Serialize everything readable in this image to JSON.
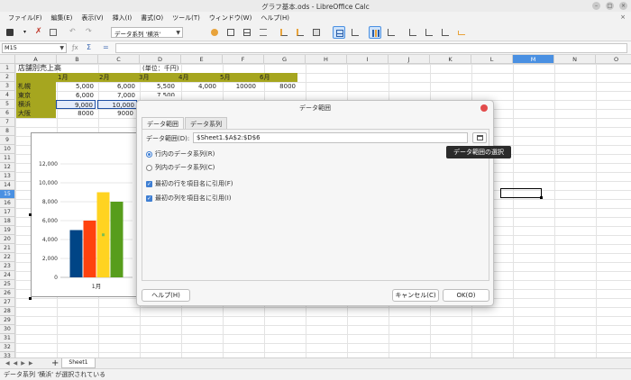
{
  "window": {
    "title": "グラフ基本.ods - LibreOffice Calc"
  },
  "menu": [
    "ファイル(F)",
    "編集(E)",
    "表示(V)",
    "挿入(I)",
    "書式(O)",
    "ツール(T)",
    "ウィンドウ(W)",
    "ヘルプ(H)"
  ],
  "toolbar": {
    "chart_element_combo": "データ系列 '横浜'"
  },
  "formula_bar": {
    "name_box": "M15",
    "sum_symbol": "Σ",
    "equals_symbol": "="
  },
  "sheet": {
    "columns": [
      "A",
      "B",
      "C",
      "D",
      "E",
      "F",
      "G",
      "H",
      "I",
      "J",
      "K",
      "L",
      "M",
      "N",
      "O"
    ],
    "active_column": "M",
    "rows": [
      "1",
      "2",
      "3",
      "4",
      "5",
      "6",
      "7",
      "8",
      "9",
      "10",
      "11",
      "12",
      "13",
      "14",
      "15",
      "16",
      "17",
      "18",
      "19",
      "20",
      "21",
      "22",
      "23",
      "24",
      "25",
      "26",
      "27",
      "28",
      "29",
      "30",
      "31",
      "32",
      "33"
    ],
    "active_row": "15",
    "title": "店舗別売上高",
    "unit": "(単位：千円)",
    "months": [
      "1月",
      "2月",
      "3月",
      "4月",
      "5月",
      "6月"
    ],
    "stores": [
      "札幌",
      "東京",
      "横浜",
      "大阪"
    ],
    "values": [
      [
        "5,000",
        "6,000",
        "5,500",
        "4,000",
        "10000",
        "8000"
      ],
      [
        "6,000",
        "7,000",
        "7,500",
        "",
        "",
        ""
      ],
      [
        "9,000",
        "10,000",
        "",
        "",
        "",
        ""
      ],
      [
        "8000",
        "9000",
        "",
        "",
        "",
        ""
      ]
    ]
  },
  "chart_data": {
    "type": "bar",
    "categories": [
      "1月"
    ],
    "series": [
      {
        "name": "札幌",
        "values": [
          5000
        ],
        "color": "#004586"
      },
      {
        "name": "東京",
        "values": [
          6000
        ],
        "color": "#ff420e"
      },
      {
        "name": "横浜",
        "values": [
          9000
        ],
        "color": "#ffd320"
      },
      {
        "name": "大阪",
        "values": [
          8000
        ],
        "color": "#579d1c"
      }
    ],
    "ylim": [
      0,
      12000
    ],
    "yticks": [
      "0",
      "2,000",
      "4,000",
      "6,000",
      "8,000",
      "10,000",
      "12,000"
    ],
    "grid": true,
    "selected_series": "横浜"
  },
  "dialog": {
    "title": "データ範囲",
    "tabs": [
      "データ範囲",
      "データ系列"
    ],
    "range_label": "データ範囲(D):",
    "range_value": "$Sheet1.$A$2:$D$6",
    "radio_rows": "行内のデータ系列(R)",
    "radio_cols": "列内のデータ系列(C)",
    "check_first_row": "最初の行を項目名に引用(F)",
    "check_first_col": "最初の列を項目名に引用(I)",
    "help_button": "ヘルプ(H)",
    "cancel_button": "キャンセル(C)",
    "ok_button": "OK(O)"
  },
  "tooltip": "データ範囲の選択",
  "sheet_tab": "Sheet1",
  "status_text": "データ系列 '横浜' が選択されている"
}
